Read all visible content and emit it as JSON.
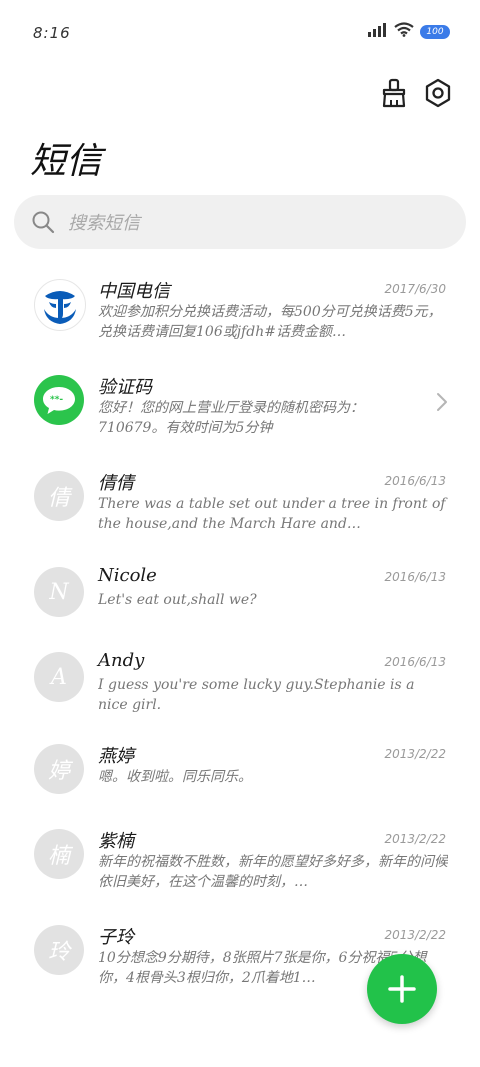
{
  "status": {
    "time": "8:16",
    "battery": "100"
  },
  "header": {
    "title": "短信",
    "clean_icon": "broom-icon",
    "settings_icon": "gear-icon"
  },
  "search": {
    "placeholder": "搜索短信"
  },
  "messages": [
    {
      "name": "中国电信",
      "date": "2017/6/30",
      "preview": "欢迎参加积分兑换话费活动，每500分可兑换话费5元，兑换话费请回复106或jfdh#话费金额…",
      "avatar": "china-telecom-logo"
    },
    {
      "name": "验证码",
      "date": "",
      "preview": "您好！您的网上营业厅登录的随机密码为：710679。有效时间为5分钟",
      "avatar": "verification-code-icon"
    },
    {
      "name": "倩倩",
      "date": "2016/6/13",
      "preview": "There was a table set out under a tree in front of the house,and the March Hare and…",
      "initial": "倩"
    },
    {
      "name": "Nicole",
      "date": "2016/6/13",
      "preview": "Let's eat out,shall we?",
      "initial": "N"
    },
    {
      "name": "Andy",
      "date": "2016/6/13",
      "preview": "I guess you're some lucky guy.Stephanie is a nice girl.",
      "initial": "A"
    },
    {
      "name": "燕婷",
      "date": "2013/2/22",
      "preview": "嗯。收到啦。同乐同乐。",
      "initial": "婷"
    },
    {
      "name": "紫楠",
      "date": "2013/2/22",
      "preview": "新年的祝福数不胜数，新年的愿望好多好多，新年的问候依旧美好，在这个温馨的时刻，…",
      "initial": "楠"
    },
    {
      "name": "子玲",
      "date": "2013/2/22",
      "preview": "10分想念9分期待，8张照片7张是你，6分祝福5分想你，4根骨头3根归你，2爪着地1…",
      "initial": "玲"
    }
  ],
  "fab": {
    "icon": "plus-icon"
  },
  "colors": {
    "accent": "#22c24a",
    "telecom_blue": "#0a5cb8",
    "battery": "#3b7be8"
  }
}
